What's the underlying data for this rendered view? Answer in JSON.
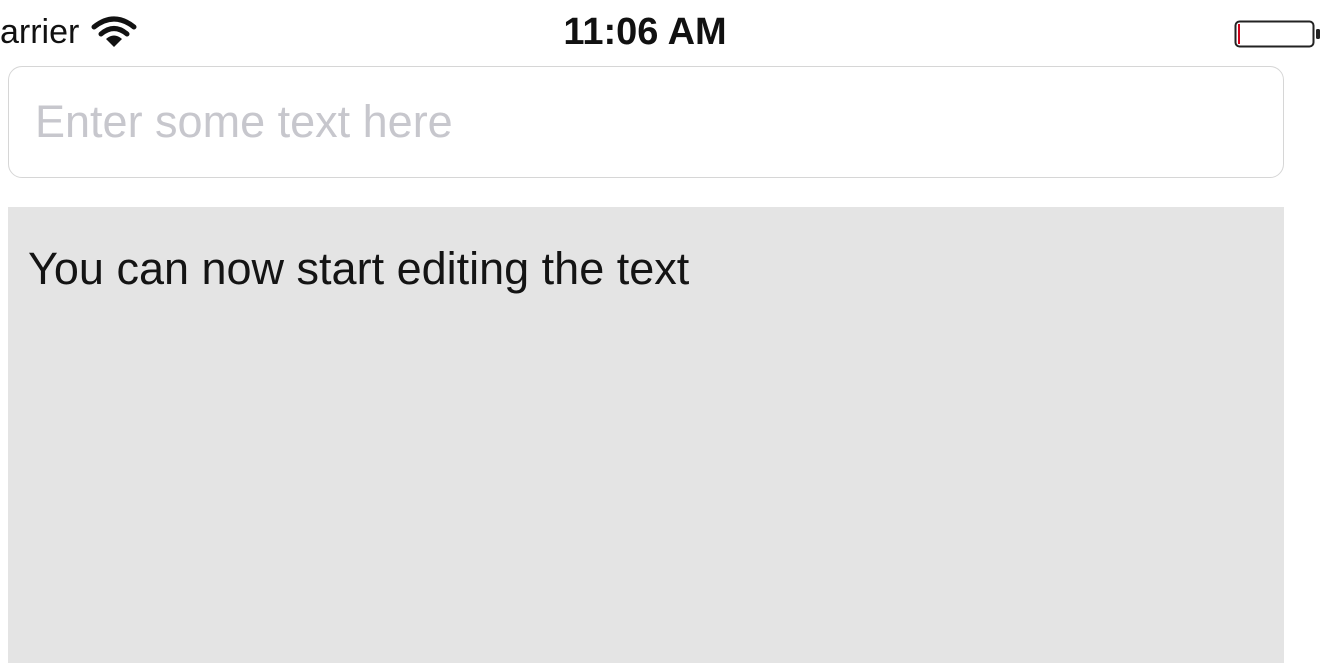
{
  "status_bar": {
    "carrier": "arrier",
    "time": "11:06 AM",
    "wifi_icon": "wifi-icon",
    "battery_icon": "battery-icon",
    "battery_level": 0.02,
    "battery_level_color": "#d0021b"
  },
  "input": {
    "placeholder": "Enter some text here",
    "value": ""
  },
  "text_area": {
    "text": "You can now start editing the text",
    "background": "#e4e4e4"
  }
}
